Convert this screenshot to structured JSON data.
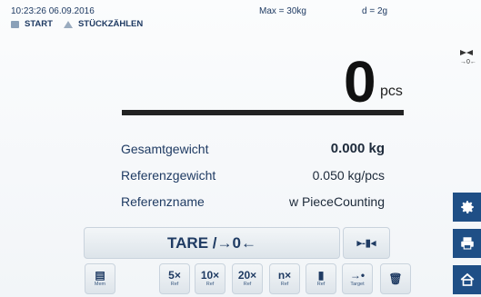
{
  "header": {
    "datetime": "10:23:26  06.09.2016",
    "max": "Max = 30kg",
    "division": "d = 2g"
  },
  "breadcrumb": {
    "start": "START",
    "mode": "STÜCKZÄHLEN"
  },
  "display": {
    "value": "0",
    "unit": "pcs"
  },
  "side_indicator": {
    "label": "→0←"
  },
  "info": {
    "rows": [
      {
        "label": "Gesamtgewicht",
        "value": "0.000 kg"
      },
      {
        "label": "Referenzgewicht",
        "value": "0.050 kg/pcs"
      },
      {
        "label": "Referenzname",
        "value": "w PieceCounting"
      }
    ]
  },
  "buttons": {
    "tare": "TARE /→0←",
    "zero": "▸-▮◂",
    "mem": {
      "main": "▤",
      "sub": "Mem"
    },
    "ref5": {
      "main": "5×",
      "sub": "Ref"
    },
    "ref10": {
      "main": "10×",
      "sub": "Ref"
    },
    "ref20": {
      "main": "20×",
      "sub": "Ref"
    },
    "refn": {
      "main": "n×",
      "sub": "Ref"
    },
    "refw": {
      "main": "▮",
      "sub": "Ref"
    },
    "target": {
      "main": "→•",
      "sub": "Target"
    },
    "trash": "🗑"
  },
  "tools": [
    "gear-icon",
    "printer-icon",
    "home-icon"
  ],
  "colors": {
    "accent": "#1f4f86",
    "text": "#1f3b63"
  }
}
